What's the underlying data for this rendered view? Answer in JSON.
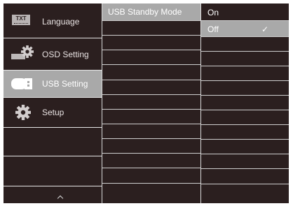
{
  "main_menu": {
    "items": [
      {
        "label": "Language",
        "icon": "txt-icon",
        "active": false
      },
      {
        "label": "OSD Setting",
        "icon": "osd-gear-icon",
        "active": false
      },
      {
        "label": "USB Setting",
        "icon": "usb-plug-icon",
        "active": true
      },
      {
        "label": "Setup",
        "icon": "gear-icon",
        "active": false
      }
    ],
    "txt_icon_text": "TXT"
  },
  "sub_menu": {
    "title": "USB Standby Mode"
  },
  "options": {
    "items": [
      {
        "label": "On",
        "selected": false
      },
      {
        "label": "Off",
        "selected": true
      }
    ],
    "check_mark": "✓"
  },
  "colors": {
    "panel": "#2b1f1f",
    "highlight": "#a9a9a9",
    "divider": "#d9d9d9"
  }
}
